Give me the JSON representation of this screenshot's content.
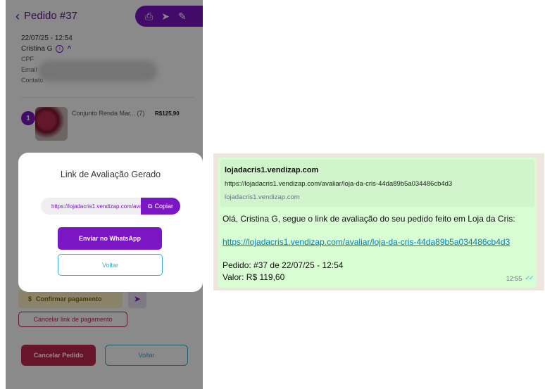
{
  "order": {
    "back_label": "Pedido #37",
    "date": "22/07/25 - 12:54",
    "customer": "Cristina G",
    "fields": [
      "CPF",
      "Email",
      "Contato"
    ],
    "item": {
      "number": "1",
      "name": "Conjunto Renda Mar... (7)",
      "price": "R$125,90"
    },
    "confirm_payment": "Confirmar pagamento",
    "cancel_payment_link": "Cancelar link de pagamento",
    "cancel_order": "Cancelar Pedido",
    "back": "Voltar"
  },
  "modal": {
    "title": "Link de Avaliação Gerado",
    "link_value": "https://lojadacris1.vendizap.com/avaliar/loja-da-cris-44da89b5a034486cb4d3",
    "copy": "Copiar",
    "send_whatsapp": "Enviar no WhatsApp",
    "back": "Voltar"
  },
  "whatsapp": {
    "preview_title": "lojadacris1.vendizap.com",
    "preview_url": "https://lojadacris1.vendizap.com/avaliar/loja-da-cris-44da89b5a034486cb4d3",
    "preview_domain": "lojadacris1.vendizap.com",
    "message": "Olá, Cristina G, segue o link de avaliação do seu pedido feito em Loja da Cris:",
    "link": "https://lojadacris1.vendizap.com/avaliar/loja-da-cris-44da89b5a034486cb4d3",
    "order_line": "Pedido: #37 de 22/07/25 - 12:54",
    "value_line": "Valor: R$ 119,60",
    "time": "12:55"
  },
  "icons": {
    "print": "print-icon",
    "send": "send-icon",
    "edit": "edit-icon",
    "info": "info-icon",
    "copy": "copy-icon",
    "read_ticks": "double-check-icon"
  },
  "colors": {
    "brand_purple": "#7a16c4",
    "accent_teal": "#2fb0c7",
    "danger": "#c1284e",
    "whatsapp_bubble": "#d9fdd3"
  }
}
